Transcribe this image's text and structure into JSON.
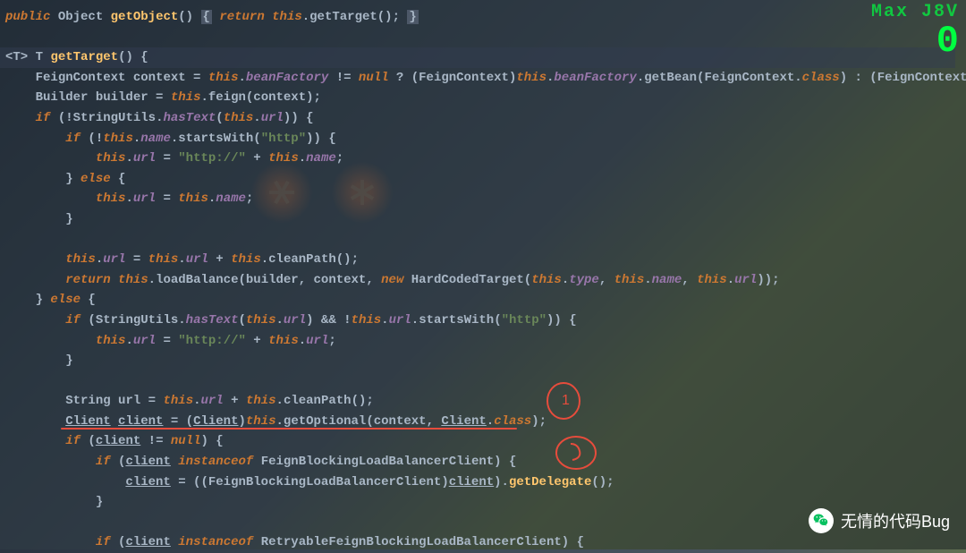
{
  "hud": {
    "label": "Max J8V",
    "value": "0"
  },
  "watermark": {
    "text": "无情的代码Bug",
    "icon": "wechat-icon"
  },
  "annotations": {
    "circle1": "1",
    "circle2": "2"
  },
  "code": {
    "line1": {
      "public": "public",
      "Object": "Object",
      "getObject": "getObject",
      "return": "return",
      "this": "this",
      "getTarget": "getTarget"
    },
    "line3": {
      "generic": "<T>",
      "T": "T",
      "getTarget": "getTarget"
    },
    "line4": {
      "FeignContext": "FeignContext",
      "context": "context",
      "this": "this",
      "beanFactory": "beanFactory",
      "null": "null",
      "getBean": "getBean",
      "class": "class"
    },
    "line5": {
      "Builder": "Builder",
      "builder": "builder",
      "this": "this",
      "feign": "feign",
      "context": "context"
    },
    "line6": {
      "if": "if",
      "StringUtils": "StringUtils",
      "hasText": "hasText",
      "this": "this",
      "url": "url"
    },
    "line7": {
      "if": "if",
      "this": "this",
      "name": "name",
      "startsWith": "startsWith",
      "str": "\"http\""
    },
    "line8": {
      "this": "this",
      "url": "url",
      "str": "\"http://\"",
      "name": "name"
    },
    "line9": {
      "else": "else"
    },
    "line10": {
      "this": "this",
      "url": "url",
      "name": "name"
    },
    "line13": {
      "this": "this",
      "url": "url",
      "cleanPath": "cleanPath"
    },
    "line14": {
      "return": "return",
      "this": "this",
      "loadBalance": "loadBalance",
      "builder": "builder",
      "context": "context",
      "new": "new",
      "HardCodedTarget": "HardCodedTarget",
      "type": "type",
      "name": "name",
      "url": "url"
    },
    "line15": {
      "else": "else"
    },
    "line16": {
      "if": "if",
      "StringUtils": "StringUtils",
      "hasText": "hasText",
      "this": "this",
      "url": "url",
      "startsWith": "startsWith",
      "str": "\"http\""
    },
    "line17": {
      "this": "this",
      "url": "url",
      "str": "\"http://\""
    },
    "line20": {
      "String": "String",
      "url": "url",
      "this": "this",
      "cleanPath": "cleanPath"
    },
    "line21": {
      "Client": "Client",
      "client": "client",
      "this": "this",
      "getOptional": "getOptional",
      "context": "context",
      "class": "class"
    },
    "line22": {
      "if": "if",
      "client": "client",
      "null": "null"
    },
    "line23": {
      "if": "if",
      "client": "client",
      "instanceof": "instanceof",
      "FeignBlockingLoadBalancerClient": "FeignBlockingLoadBalancerClient"
    },
    "line24": {
      "client": "client",
      "FeignBlockingLoadBalancerClient": "FeignBlockingLoadBalancerClient",
      "getDelegate": "getDelegate"
    },
    "line27": {
      "if": "if",
      "client": "client",
      "instanceof": "instanceof",
      "RetryableFeignBlockingLoadBalancerClient": "RetryableFeignBlockingLoadBalancerClient"
    }
  }
}
